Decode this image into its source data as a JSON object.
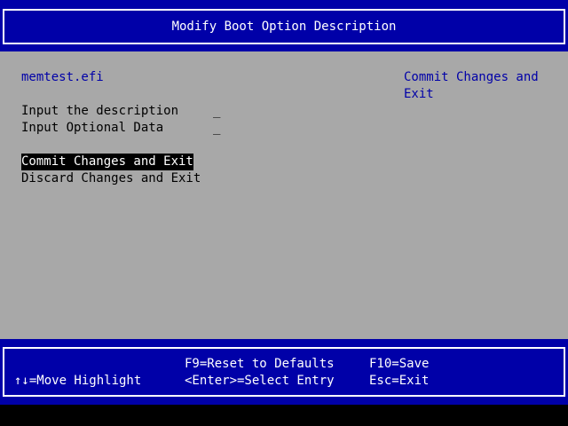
{
  "header": {
    "title": "Modify Boot Option Description"
  },
  "main": {
    "file_name": "memtest.efi",
    "fields": [
      {
        "label": "Input the description",
        "value": "_"
      },
      {
        "label": "Input Optional Data",
        "value": "_"
      }
    ],
    "actions": [
      {
        "label": "Commit Changes and Exit",
        "selected": true
      },
      {
        "label": "Discard Changes and Exit",
        "selected": false
      }
    ],
    "help_text_line1": "Commit Changes and",
    "help_text_line2": "Exit"
  },
  "footer": {
    "move_highlight": "↑↓=Move Highlight",
    "reset_defaults": "F9=Reset to Defaults",
    "select_entry": "<Enter>=Select Entry",
    "save": "F10=Save",
    "exit": "Esc=Exit"
  },
  "colors": {
    "header_bg": "#0000a8",
    "panel_bg": "#a8a8a8",
    "accent_text": "#0000a8",
    "highlight_bg": "#000000",
    "highlight_fg": "#ffffff"
  }
}
